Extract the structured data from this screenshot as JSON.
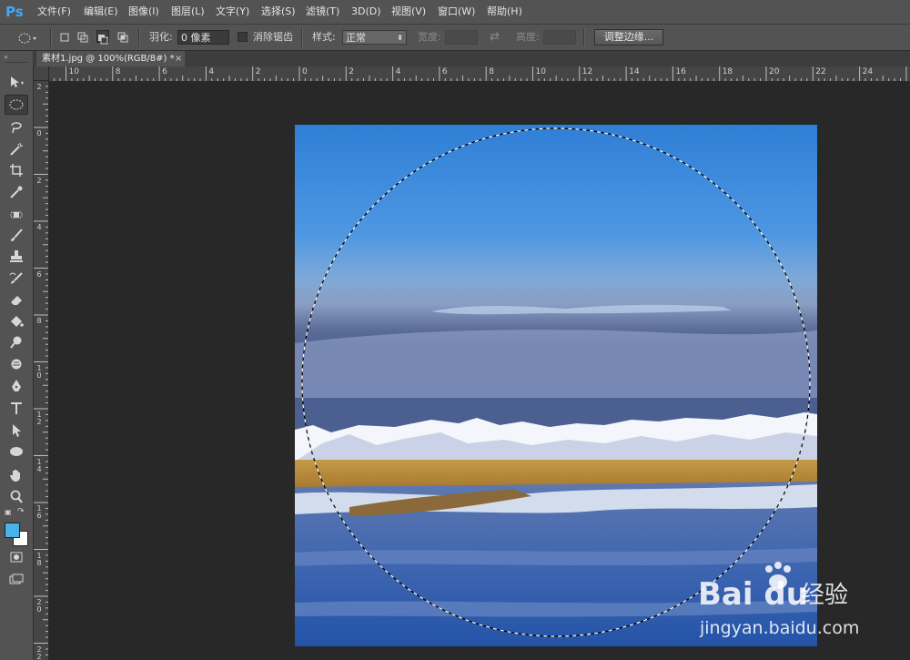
{
  "app": {
    "logo": "Ps"
  },
  "menu": [
    "文件(F)",
    "编辑(E)",
    "图像(I)",
    "图层(L)",
    "文字(Y)",
    "选择(S)",
    "滤镜(T)",
    "3D(D)",
    "视图(V)",
    "窗口(W)",
    "帮助(H)"
  ],
  "options": {
    "feather_label": "羽化:",
    "feather_value": "0 像素",
    "antialias_label": "消除锯齿",
    "style_label": "样式:",
    "style_value": "正常",
    "width_label": "宽度:",
    "height_label": "高度:",
    "refine_button": "调整边缘..."
  },
  "document": {
    "tab_title": "素材1.jpg @ 100%(RGB/8#) *",
    "close": "×"
  },
  "ruler": {
    "h_labels": [
      "10",
      "8",
      "6",
      "4",
      "2",
      "0",
      "2",
      "4",
      "6",
      "8",
      "10",
      "12",
      "14",
      "16",
      "18",
      "20",
      "22",
      "24"
    ],
    "v_labels": [
      "2",
      "0",
      "2",
      "4",
      "6",
      "8",
      "10",
      "12",
      "14",
      "16",
      "18",
      "20",
      "22"
    ]
  },
  "colors": {
    "foreground": "#49b3e8",
    "background": "#ffffff",
    "accent": "#3fa9f5"
  },
  "watermark": {
    "brand": "Bai du",
    "brand_cn": "经验",
    "url": "jingyan.baidu.com"
  },
  "icons": [
    "move-icon",
    "elliptical-marquee-icon",
    "lasso-icon",
    "magic-wand-icon",
    "crop-icon",
    "eyedropper-icon",
    "spot-healing-icon",
    "brush-icon",
    "clone-stamp-icon",
    "history-brush-icon",
    "eraser-icon",
    "paint-bucket-icon",
    "dodge-icon",
    "blur-icon",
    "pen-icon",
    "type-icon",
    "path-selection-icon",
    "ellipse-shape-icon",
    "hand-icon",
    "zoom-icon",
    "quick-mask-icon",
    "screen-mode-icon"
  ]
}
